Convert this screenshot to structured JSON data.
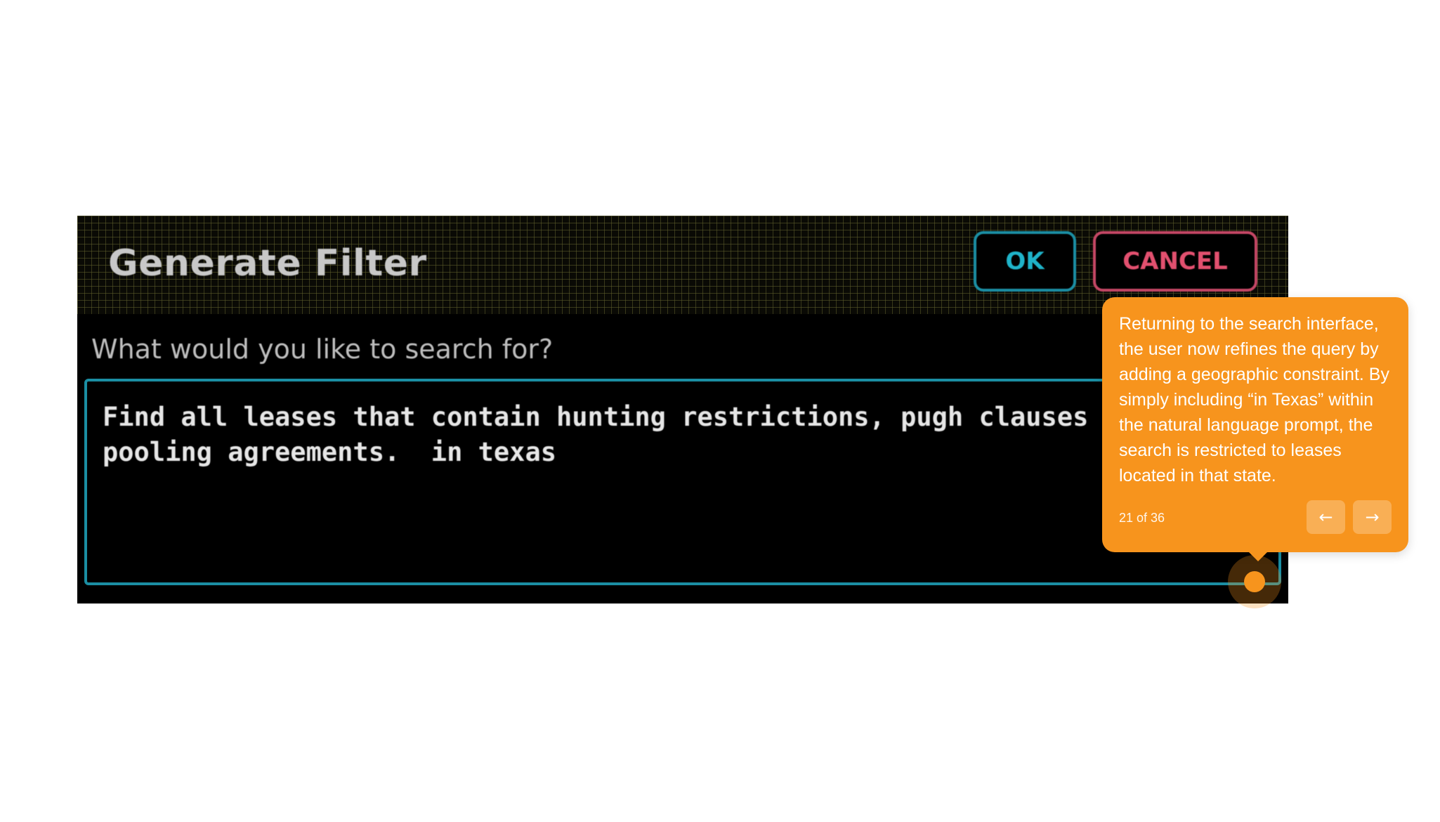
{
  "dialog": {
    "title": "Generate Filter",
    "ok_label": "OK",
    "cancel_label": "CANCEL",
    "prompt_label": "What would you like to search for?",
    "query_text": "Find all leases that contain hunting restrictions, pugh clauses\npooling agreements.  in texas"
  },
  "tooltip": {
    "text": "Returning to the search interface, the user now refines the query by adding a geographic constraint. By simply including “in Texas” within the natural language prompt, the search is restricted to leases located in that state.",
    "counter": "21 of 36",
    "prev_icon": "arrow-left-icon",
    "next_icon": "arrow-right-icon",
    "prev_glyph": "←",
    "next_glyph": "→"
  },
  "colors": {
    "tooltip_bg": "#f7941d",
    "ok_accent": "#1fb3c9",
    "cancel_accent": "#e2506f"
  }
}
